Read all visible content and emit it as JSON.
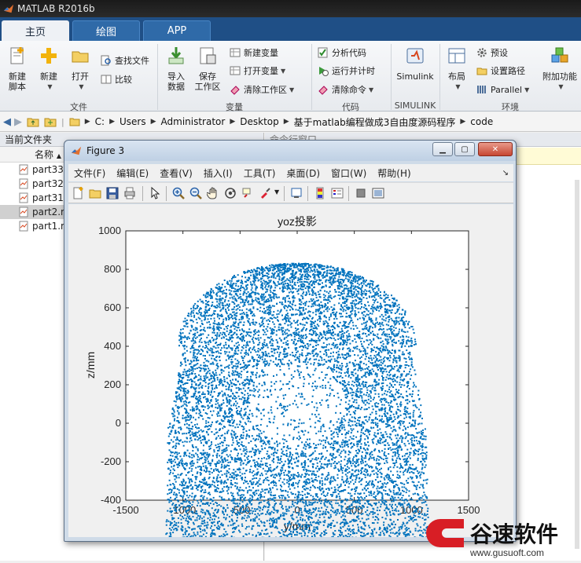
{
  "app": {
    "title": "MATLAB R2016b"
  },
  "tabs": [
    {
      "label": "主页"
    },
    {
      "label": "绘图"
    },
    {
      "label": "APP"
    }
  ],
  "ribbon": {
    "file": {
      "new_script": "新建\n脚本",
      "new": "新建",
      "open": "打开",
      "find_files": "查找文件",
      "compare": "比较",
      "section": "文件"
    },
    "variable": {
      "import_data": "导入\n数据",
      "save_workspace": "保存\n工作区",
      "new_variable": "新建变量",
      "open_variable": "打开变量",
      "clear_workspace": "清除工作区",
      "section": "变量"
    },
    "code": {
      "analyze_code": "分析代码",
      "run_and_time": "运行并计时",
      "clear_commands": "清除命令",
      "section": "代码"
    },
    "simulink": {
      "label": "Simulink",
      "section": "SIMULINK"
    },
    "environment": {
      "layout": "布局",
      "preferences": "预设",
      "set_path": "设置路径",
      "parallel": "Parallel",
      "addons": "附加功能",
      "section": "环境"
    }
  },
  "address": {
    "crumbs": [
      "C:",
      "Users",
      "Administrator",
      "Desktop",
      "基于matlab编程做成3自由度源码程序",
      "code"
    ]
  },
  "left_panel": {
    "title": "当前文件夹",
    "column_name": "名称",
    "files": [
      "part33.m",
      "part32.m",
      "part31.m",
      "part2.m",
      "part1.m"
    ],
    "selected_index": 3
  },
  "right_panel": {
    "title": "命令行窗口"
  },
  "figure": {
    "title": "Figure 3",
    "menu": [
      "文件(F)",
      "编辑(E)",
      "查看(V)",
      "插入(I)",
      "工具(T)",
      "桌面(D)",
      "窗口(W)",
      "帮助(H)"
    ]
  },
  "chart_data": {
    "type": "scatter",
    "title": "yoz投影",
    "xlabel": "y/mm",
    "ylabel": "z/mm",
    "xlim": [
      -1500,
      1500
    ],
    "ylim": [
      -400,
      1000
    ],
    "xticks": [
      -1500,
      -1000,
      -500,
      0,
      500,
      1000,
      1500
    ],
    "yticks": [
      -400,
      -200,
      0,
      200,
      400,
      600,
      800,
      1000
    ],
    "grid": false,
    "marker_color": "#0072bd",
    "series": [
      {
        "points_approx": 9000,
        "shape": "dome — dense point cloud spanning y≈[-1150,1150], z≈[-590,830]; outer boundary narrows above z≈400 to y≈[-950,900] and peaks near z≈820; lower region widens to |y|≈1150; sparser hollow core near y≈0, z≈-200..400"
      }
    ]
  },
  "watermark": {
    "text": "谷速软件",
    "url": "www.gusuoft.com"
  },
  "colors": {
    "tabbar": "#1f4f86",
    "plot_blue": "#0072bd",
    "figure_frame": "#cfdbe8",
    "watermark_red": "#d81e25"
  }
}
